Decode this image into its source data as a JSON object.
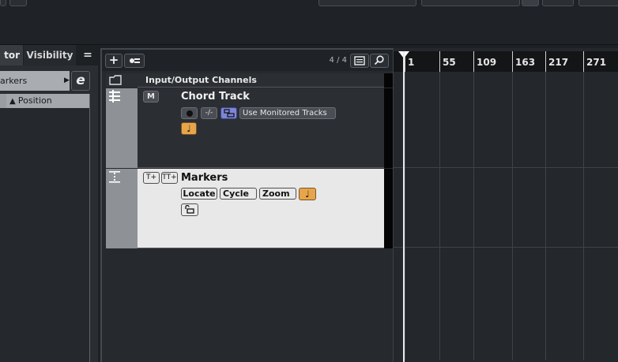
{
  "inspector": {
    "tab_active": "tor",
    "tab_visibility": "Visibility",
    "menu_glyph": "=",
    "section_label": "arkers",
    "edit_glyph": "e",
    "column_header": "Position"
  },
  "track_list": {
    "count": "4 / 4",
    "add_glyph": "+",
    "tracks": [
      {
        "name": "Input/Output Channels"
      },
      {
        "name": "Chord Track",
        "monitor_label": "Use Monitored Tracks",
        "m_label": "M"
      },
      {
        "name": "Markers",
        "buttons": [
          "Locate",
          "Cycle",
          "Zoom"
        ],
        "marker_buttons": [
          "T+",
          "TT+"
        ]
      }
    ]
  },
  "ruler": {
    "bars": [
      "1",
      "55",
      "109",
      "163",
      "217",
      "271"
    ]
  },
  "colors": {
    "accent_orange": "#e7a54b",
    "markers_bg": "#e8e8e8",
    "dark_bg": "#1d2024"
  },
  "icons": {
    "folder": "folder-icon",
    "chord": "chord-track-icon",
    "marker": "marker-track-icon",
    "note": "music-note-icon",
    "lock": "lock-icon",
    "search": "search-icon",
    "list": "list-icon"
  }
}
